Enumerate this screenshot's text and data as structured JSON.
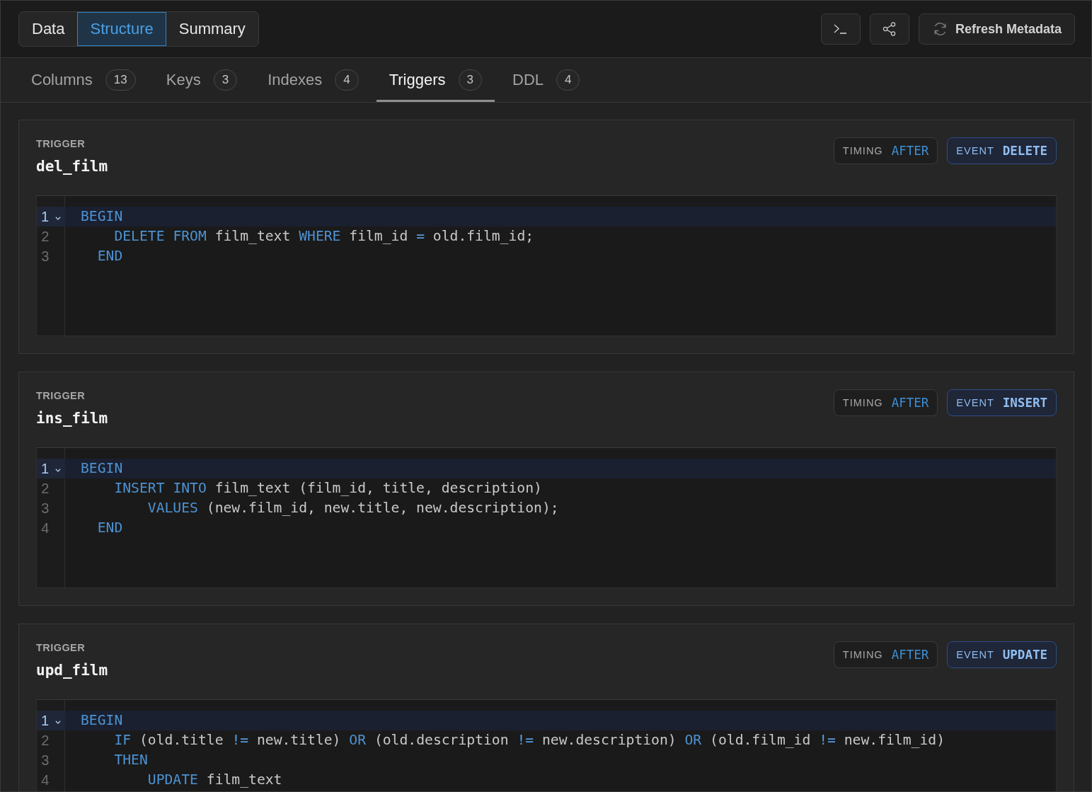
{
  "view_tabs": [
    {
      "label": "Data",
      "selected": false
    },
    {
      "label": "Structure",
      "selected": true
    },
    {
      "label": "Summary",
      "selected": false
    }
  ],
  "toolbar": {
    "refresh_button": "Refresh Metadata"
  },
  "section_tabs": [
    {
      "label": "Columns",
      "count": "13",
      "selected": false
    },
    {
      "label": "Keys",
      "count": "3",
      "selected": false
    },
    {
      "label": "Indexes",
      "count": "4",
      "selected": false
    },
    {
      "label": "Triggers",
      "count": "3",
      "selected": true
    },
    {
      "label": "DDL",
      "count": "4",
      "selected": false
    }
  ],
  "triggers": [
    {
      "label": "TRIGGER",
      "name": "del_film",
      "timing": {
        "label": "TIMING",
        "value": "AFTER"
      },
      "event": {
        "label": "EVENT",
        "value": "DELETE"
      },
      "code": [
        {
          "number": "1",
          "active": true,
          "foldable": true,
          "tokens": [
            {
              "kind": "keyword",
              "text": "BEGIN"
            }
          ]
        },
        {
          "number": "2",
          "active": false,
          "foldable": false,
          "tokens": [
            {
              "kind": "keyword",
              "text": "    DELETE FROM"
            },
            {
              "kind": "plain",
              "text": " film_text "
            },
            {
              "kind": "keyword",
              "text": "WHERE"
            },
            {
              "kind": "plain",
              "text": " film_id "
            },
            {
              "kind": "operator",
              "text": "="
            },
            {
              "kind": "plain",
              "text": " old.film_id;"
            }
          ]
        },
        {
          "number": "3",
          "active": false,
          "foldable": false,
          "tokens": [
            {
              "kind": "keyword",
              "text": "  END"
            }
          ]
        }
      ]
    },
    {
      "label": "TRIGGER",
      "name": "ins_film",
      "timing": {
        "label": "TIMING",
        "value": "AFTER"
      },
      "event": {
        "label": "EVENT",
        "value": "INSERT"
      },
      "code": [
        {
          "number": "1",
          "active": true,
          "foldable": true,
          "tokens": [
            {
              "kind": "keyword",
              "text": "BEGIN"
            }
          ]
        },
        {
          "number": "2",
          "active": false,
          "foldable": false,
          "tokens": [
            {
              "kind": "keyword",
              "text": "    INSERT INTO"
            },
            {
              "kind": "plain",
              "text": " film_text (film_id, title, description)"
            }
          ]
        },
        {
          "number": "3",
          "active": false,
          "foldable": false,
          "tokens": [
            {
              "kind": "keyword",
              "text": "        VALUES"
            },
            {
              "kind": "plain",
              "text": " (new.film_id, new.title, new.description);"
            }
          ]
        },
        {
          "number": "4",
          "active": false,
          "foldable": false,
          "tokens": [
            {
              "kind": "keyword",
              "text": "  END"
            }
          ]
        }
      ]
    },
    {
      "label": "TRIGGER",
      "name": "upd_film",
      "timing": {
        "label": "TIMING",
        "value": "AFTER"
      },
      "event": {
        "label": "EVENT",
        "value": "UPDATE"
      },
      "code": [
        {
          "number": "1",
          "active": true,
          "foldable": true,
          "tokens": [
            {
              "kind": "keyword",
              "text": "BEGIN"
            }
          ]
        },
        {
          "number": "2",
          "active": false,
          "foldable": false,
          "tokens": [
            {
              "kind": "keyword",
              "text": "    IF"
            },
            {
              "kind": "plain",
              "text": " (old.title "
            },
            {
              "kind": "operator",
              "text": "!="
            },
            {
              "kind": "plain",
              "text": " new.title) "
            },
            {
              "kind": "keyword",
              "text": "OR"
            },
            {
              "kind": "plain",
              "text": " (old.description "
            },
            {
              "kind": "operator",
              "text": "!="
            },
            {
              "kind": "plain",
              "text": " new.description) "
            },
            {
              "kind": "keyword",
              "text": "OR"
            },
            {
              "kind": "plain",
              "text": " (old.film_id "
            },
            {
              "kind": "operator",
              "text": "!="
            },
            {
              "kind": "plain",
              "text": " new.film_id)"
            }
          ]
        },
        {
          "number": "3",
          "active": false,
          "foldable": false,
          "tokens": [
            {
              "kind": "keyword",
              "text": "    THEN"
            }
          ]
        },
        {
          "number": "4",
          "active": false,
          "foldable": false,
          "tokens": [
            {
              "kind": "keyword",
              "text": "        UPDATE"
            },
            {
              "kind": "plain",
              "text": " film_text"
            }
          ]
        }
      ]
    }
  ]
}
